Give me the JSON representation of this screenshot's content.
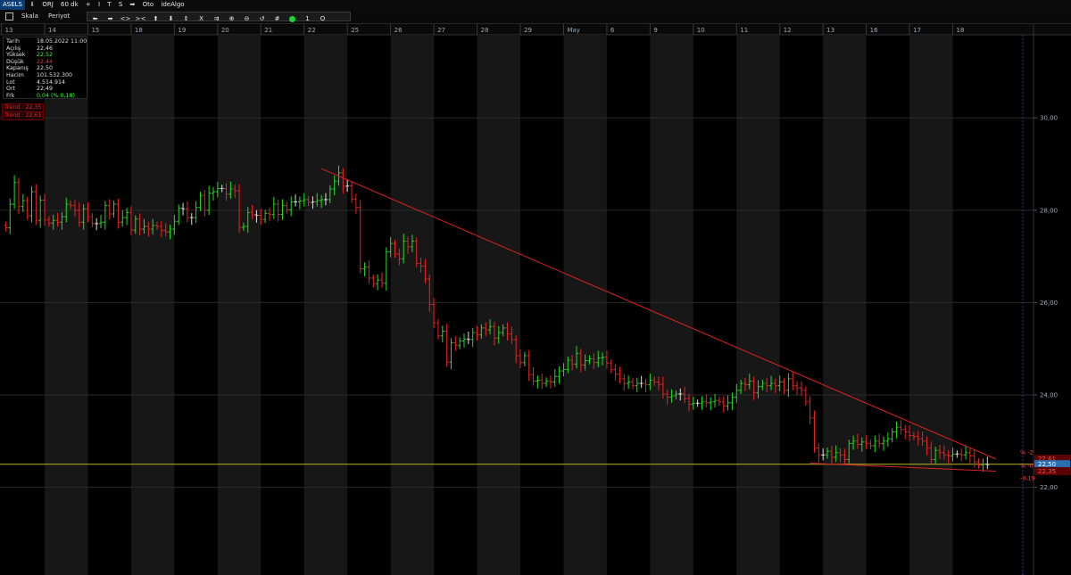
{
  "topbar": {
    "symbol": "ASELS",
    "items": [
      "⬇",
      "ORJ",
      "60 dk",
      "+",
      "I",
      "T",
      "S",
      "➡",
      "Oto",
      "ideAlgo"
    ]
  },
  "toolbar": {
    "scale_label": "Skala",
    "period_label": "Periyot",
    "buttons": [
      "⬅",
      "➡",
      "<>",
      "><",
      "⬆",
      "⬇",
      "⇕",
      "X",
      "⇉",
      "⊕",
      "⊖",
      "↺",
      "#",
      "",
      "1",
      "O"
    ]
  },
  "info": {
    "rows": [
      {
        "label": "Tarih",
        "value": "18.05.2022 11:00",
        "color": "#e0e0e0"
      },
      {
        "label": "Açılış",
        "value": "22,46",
        "color": "#e0e0e0"
      },
      {
        "label": "Yüksek",
        "value": "22,52",
        "color": "#33ff33"
      },
      {
        "label": "Düşük",
        "value": "22,44",
        "color": "#ff3030"
      },
      {
        "label": "Kapanış",
        "value": "22,50",
        "color": "#e0e0e0"
      },
      {
        "label": "Hacim",
        "value": "101.532.300",
        "color": "#e0e0e0"
      },
      {
        "label": "Lot",
        "value": "4.514.914",
        "color": "#e0e0e0"
      },
      {
        "label": "Ort",
        "value": "22,49",
        "color": "#e0e0e0"
      },
      {
        "label": "Frk",
        "value": "0,04 (% 0,18)",
        "color": "#33ff33"
      }
    ]
  },
  "trends": [
    "Trend : 22,35",
    "Trend : 22,61"
  ],
  "price_tags": {
    "upper_trend": "22,61",
    "last_price": "22,50",
    "lower_trend": "22,35",
    "pct_upper": "% -2",
    "pct_mid": "% -0",
    "pct_lower": "-0,19"
  },
  "chart_data": {
    "type": "ohlc",
    "title": "",
    "xlabel": "",
    "ylabel": "",
    "y_ticks": [
      "30,00",
      "28,00",
      "26,00",
      "24,00",
      "22,00"
    ],
    "y_values": [
      30,
      28,
      26,
      24,
      22
    ],
    "ylim": [
      20.1,
      31.8
    ],
    "x_ticks": [
      "13",
      "14",
      "15",
      "18",
      "19",
      "20",
      "21",
      "22",
      "25",
      "26",
      "27",
      "28",
      "29",
      "May",
      "6",
      "9",
      "10",
      "11",
      "12",
      "13",
      "16",
      "17",
      "18"
    ],
    "bars_per_day": 10,
    "grid": true,
    "colors": {
      "up": "#22dd22",
      "down": "#ee2222",
      "neutral": "#dddddd",
      "trend": "#dd2222",
      "horizontal": "#b5b52a",
      "band_dark": "#171717"
    },
    "horizontal_line": 22.5,
    "trendlines": [
      {
        "x1": 73,
        "y1": 28.9,
        "x2": 229,
        "y2": 22.61
      },
      {
        "x1": 186,
        "y1": 22.52,
        "x2": 229,
        "y2": 22.35
      }
    ],
    "closes": [
      [
        0,
        6,
        27.62
      ],
      [
        1,
        10,
        28.13
      ],
      [
        2,
        8,
        28.6
      ],
      [
        3,
        8,
        28.08
      ],
      [
        4,
        8,
        28.21
      ],
      [
        5,
        10,
        27.88
      ],
      [
        6,
        8,
        28.4
      ],
      [
        7,
        8,
        27.78
      ],
      [
        8,
        8,
        28.22
      ],
      [
        9,
        8,
        27.79
      ],
      [
        10,
        8,
        27.72
      ],
      [
        11,
        8,
        27.78
      ],
      [
        12,
        8,
        27.74
      ],
      [
        13,
        8,
        27.86
      ],
      [
        14,
        8,
        28.13
      ],
      [
        15,
        8,
        28.1
      ],
      [
        16,
        8,
        28.0
      ],
      [
        17,
        8,
        27.74
      ],
      [
        18,
        8,
        28.03
      ],
      [
        19,
        8,
        27.86
      ],
      [
        20,
        8,
        27.71
      ],
      [
        21,
        8,
        27.71
      ],
      [
        22,
        8,
        27.74
      ],
      [
        23,
        8,
        28.1
      ],
      [
        24,
        8,
        27.92
      ],
      [
        25,
        8,
        28.13
      ],
      [
        26,
        8,
        27.74
      ],
      [
        27,
        8,
        27.84
      ],
      [
        28,
        8,
        27.95
      ],
      [
        29,
        8,
        27.57
      ],
      [
        30,
        8,
        27.81
      ],
      [
        31,
        8,
        27.59
      ],
      [
        32,
        8,
        27.65
      ],
      [
        33,
        8,
        27.59
      ],
      [
        34,
        8,
        27.67
      ],
      [
        35,
        8,
        27.65
      ],
      [
        36,
        8,
        27.56
      ],
      [
        37,
        8,
        27.53
      ],
      [
        38,
        8,
        27.59
      ],
      [
        39,
        8,
        27.76
      ],
      [
        40,
        8,
        28.04
      ],
      [
        41,
        8,
        28.03
      ],
      [
        42,
        8,
        27.84
      ],
      [
        43,
        8,
        27.84
      ],
      [
        44,
        8,
        28.06
      ],
      [
        45,
        8,
        28.32
      ],
      [
        46,
        8,
        28.0
      ],
      [
        47,
        8,
        28.37
      ],
      [
        48,
        8,
        28.4
      ],
      [
        49,
        8,
        28.47
      ],
      [
        50,
        8,
        28.47
      ],
      [
        51,
        8,
        28.35
      ],
      [
        52,
        8,
        28.46
      ],
      [
        53,
        8,
        28.42
      ],
      [
        54,
        8,
        27.63
      ],
      [
        55,
        8,
        27.65
      ],
      [
        56,
        8,
        27.95
      ],
      [
        57,
        8,
        27.9
      ],
      [
        58,
        8,
        27.89
      ],
      [
        59,
        8,
        27.8
      ],
      [
        60,
        8,
        27.93
      ],
      [
        61,
        8,
        27.91
      ],
      [
        62,
        8,
        28.13
      ],
      [
        63,
        8,
        27.91
      ],
      [
        64,
        8,
        28.1
      ],
      [
        65,
        8,
        28.01
      ],
      [
        66,
        8,
        28.18
      ],
      [
        67,
        8,
        28.18
      ],
      [
        68,
        8,
        28.2
      ],
      [
        69,
        8,
        28.23
      ],
      [
        70,
        8,
        28.17
      ],
      [
        71,
        8,
        28.18
      ],
      [
        72,
        8,
        28.21
      ],
      [
        73,
        8,
        28.23
      ],
      [
        74,
        8,
        28.23
      ],
      [
        75,
        8,
        28.46
      ],
      [
        76,
        8,
        28.63
      ],
      [
        77,
        8,
        28.81
      ],
      [
        78,
        8,
        28.52
      ],
      [
        79,
        8,
        28.53
      ],
      [
        80,
        8,
        28.24
      ],
      [
        81,
        8,
        28.06
      ],
      [
        82,
        8,
        26.73
      ],
      [
        83,
        8,
        26.77
      ],
      [
        84,
        8,
        26.53
      ],
      [
        85,
        8,
        26.41
      ],
      [
        86,
        8,
        26.49
      ],
      [
        87,
        8,
        26.42
      ],
      [
        88,
        8,
        27.1
      ],
      [
        89,
        8,
        27.28
      ],
      [
        90,
        8,
        27.05
      ],
      [
        91,
        8,
        26.95
      ],
      [
        92,
        8,
        27.33
      ],
      [
        93,
        8,
        27.21
      ],
      [
        94,
        8,
        27.33
      ],
      [
        95,
        8,
        26.85
      ],
      [
        96,
        8,
        26.79
      ],
      [
        97,
        8,
        26.51
      ],
      [
        98,
        8,
        25.96
      ],
      [
        99,
        8,
        25.56
      ],
      [
        100,
        8,
        25.28
      ],
      [
        101,
        8,
        25.38
      ],
      [
        102,
        8,
        24.71
      ],
      [
        103,
        8,
        25.13
      ],
      [
        104,
        8,
        25.07
      ],
      [
        105,
        8,
        25.17
      ],
      [
        106,
        8,
        25.21
      ],
      [
        107,
        8,
        25.2
      ],
      [
        108,
        8,
        25.35
      ],
      [
        109,
        8,
        25.3
      ],
      [
        110,
        8,
        25.45
      ],
      [
        111,
        8,
        25.41
      ],
      [
        112,
        8,
        25.48
      ],
      [
        113,
        8,
        25.23
      ],
      [
        114,
        8,
        25.35
      ],
      [
        115,
        8,
        25.45
      ],
      [
        116,
        8,
        25.32
      ],
      [
        117,
        8,
        25.2
      ],
      [
        118,
        8,
        24.85
      ],
      [
        119,
        8,
        24.7
      ],
      [
        120,
        8,
        24.85
      ],
      [
        121,
        8,
        24.44
      ],
      [
        122,
        8,
        24.3
      ],
      [
        123,
        8,
        24.32
      ],
      [
        124,
        8,
        24.25
      ],
      [
        125,
        8,
        24.3
      ],
      [
        126,
        8,
        24.28
      ],
      [
        127,
        8,
        24.4
      ],
      [
        128,
        8,
        24.52
      ],
      [
        129,
        8,
        24.55
      ],
      [
        130,
        8,
        24.75
      ],
      [
        131,
        8,
        24.67
      ],
      [
        132,
        8,
        24.9
      ],
      [
        133,
        8,
        24.65
      ],
      [
        134,
        8,
        24.74
      ],
      [
        135,
        8,
        24.78
      ],
      [
        136,
        8,
        24.7
      ],
      [
        137,
        8,
        24.8
      ],
      [
        138,
        8,
        24.82
      ],
      [
        139,
        8,
        24.69
      ],
      [
        140,
        8,
        24.55
      ],
      [
        141,
        8,
        24.45
      ],
      [
        142,
        8,
        24.35
      ],
      [
        143,
        8,
        24.25
      ],
      [
        144,
        8,
        24.28
      ],
      [
        145,
        8,
        24.2
      ],
      [
        146,
        8,
        24.25
      ],
      [
        147,
        8,
        24.25
      ],
      [
        148,
        8,
        24.22
      ],
      [
        149,
        8,
        24.32
      ],
      [
        150,
        8,
        24.28
      ],
      [
        151,
        8,
        24.23
      ],
      [
        152,
        8,
        24.02
      ],
      [
        153,
        8,
        23.95
      ],
      [
        154,
        8,
        23.98
      ],
      [
        155,
        8,
        24.02
      ],
      [
        156,
        8,
        24.02
      ],
      [
        157,
        8,
        23.92
      ],
      [
        158,
        8,
        23.8
      ],
      [
        159,
        8,
        23.82
      ],
      [
        160,
        8,
        23.82
      ],
      [
        161,
        8,
        23.85
      ],
      [
        162,
        8,
        23.83
      ],
      [
        163,
        8,
        23.85
      ],
      [
        164,
        8,
        23.88
      ],
      [
        165,
        8,
        23.85
      ],
      [
        166,
        8,
        23.76
      ],
      [
        167,
        8,
        23.83
      ],
      [
        168,
        8,
        23.95
      ],
      [
        169,
        8,
        24.1
      ],
      [
        170,
        8,
        24.25
      ],
      [
        171,
        8,
        24.22
      ],
      [
        172,
        8,
        24.3
      ],
      [
        173,
        8,
        24.05
      ],
      [
        174,
        8,
        24.18
      ],
      [
        175,
        8,
        24.25
      ],
      [
        176,
        8,
        24.2
      ],
      [
        177,
        8,
        24.25
      ],
      [
        178,
        8,
        24.2
      ],
      [
        179,
        8,
        24.28
      ],
      [
        180,
        8,
        24.1
      ],
      [
        181,
        8,
        24.35
      ],
      [
        182,
        8,
        24.2
      ],
      [
        183,
        8,
        24.15
      ],
      [
        184,
        8,
        24.1
      ],
      [
        185,
        8,
        23.85
      ],
      [
        186,
        8,
        23.5
      ],
      [
        187,
        8,
        22.85
      ],
      [
        188,
        8,
        22.7
      ],
      [
        189,
        8,
        22.7
      ],
      [
        190,
        8,
        22.78
      ],
      [
        191,
        8,
        22.65
      ],
      [
        192,
        8,
        22.75
      ],
      [
        193,
        8,
        22.7
      ],
      [
        194,
        8,
        22.6
      ],
      [
        195,
        8,
        22.95
      ],
      [
        196,
        8,
        23.0
      ],
      [
        197,
        8,
        22.93
      ],
      [
        198,
        8,
        22.98
      ],
      [
        199,
        8,
        22.95
      ],
      [
        200,
        8,
        22.9
      ],
      [
        201,
        8,
        23.0
      ],
      [
        202,
        8,
        22.95
      ],
      [
        203,
        8,
        23.0
      ],
      [
        204,
        8,
        23.05
      ],
      [
        205,
        8,
        23.2
      ],
      [
        206,
        8,
        23.3
      ],
      [
        207,
        8,
        23.25
      ],
      [
        208,
        8,
        23.2
      ],
      [
        209,
        8,
        23.12
      ],
      [
        210,
        8,
        23.1
      ],
      [
        211,
        8,
        23.05
      ],
      [
        212,
        8,
        23.0
      ],
      [
        213,
        8,
        22.85
      ],
      [
        214,
        8,
        22.6
      ],
      [
        215,
        8,
        22.8
      ],
      [
        216,
        8,
        22.75
      ],
      [
        217,
        8,
        22.7
      ],
      [
        218,
        8,
        22.68
      ],
      [
        219,
        8,
        22.72
      ],
      [
        220,
        8,
        22.72
      ],
      [
        221,
        8,
        22.7
      ],
      [
        222,
        8,
        22.75
      ],
      [
        223,
        8,
        22.68
      ],
      [
        224,
        8,
        22.55
      ],
      [
        225,
        8,
        22.48
      ],
      [
        226,
        8,
        22.5
      ],
      [
        227,
        8,
        22.49
      ]
    ]
  }
}
